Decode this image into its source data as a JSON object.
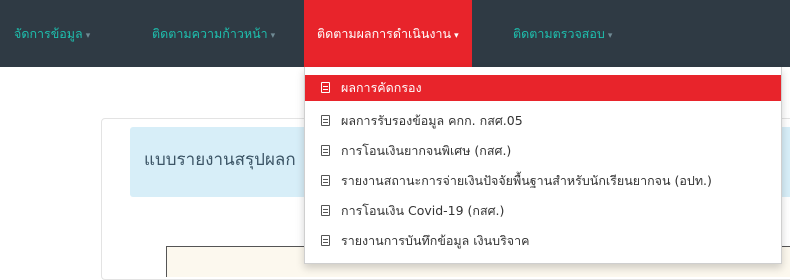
{
  "nav": {
    "items": [
      {
        "label": "จัดการข้อมูล",
        "caret": "▾"
      },
      {
        "label": "ติดตามความก้าวหน้า",
        "caret": "▾"
      },
      {
        "label": "ติดตามผลการดำเนินงาน",
        "caret": "▾",
        "active": true
      },
      {
        "label": "ติดตามตรวจสอบ",
        "caret": "▾"
      }
    ]
  },
  "card": {
    "title": "แบบรายงานสรุปผลก"
  },
  "dropdown": {
    "items": [
      {
        "label": "ผลการคัดกรอง",
        "icon": "list-icon",
        "active": true
      },
      {
        "label": "ผลการรับรองข้อมูล คกก. กสศ.05",
        "icon": "list-icon"
      },
      {
        "label": "การโอนเงินยากจนพิเศษ (กสศ.)",
        "icon": "list-icon"
      },
      {
        "label": "รายงานสถานะการจ่ายเงินปัจจัยพื้นฐานสำหรับนักเรียนยากจน (อปท.)",
        "icon": "list-icon"
      },
      {
        "label": "การโอนเงิน Covid-19 (กสศ.)",
        "icon": "list-icon"
      },
      {
        "label": "รายงานการบันทึกข้อมูล เงินบริจาค",
        "icon": "list-icon"
      }
    ]
  },
  "colors": {
    "navbar": "#2f3a44",
    "accent": "#1ebfae",
    "active": "#e8242b",
    "header_bg": "#d7eef8"
  }
}
